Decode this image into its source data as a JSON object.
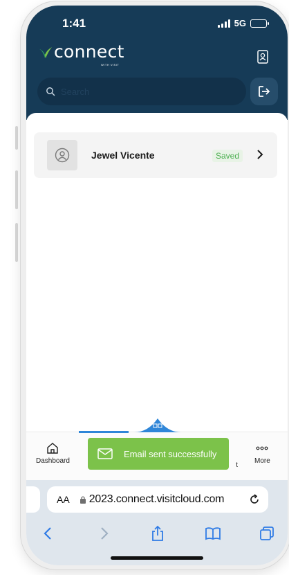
{
  "status_bar": {
    "time": "1:41",
    "network": "5G"
  },
  "header": {
    "brand": "connect",
    "brand_sub": "WITH VISIT",
    "search_placeholder": "Search",
    "colors": {
      "header_bg": "#163b57",
      "accent": "#2f86d8",
      "brand_v": "#2e9e5e"
    }
  },
  "contacts": [
    {
      "name": "Jewel Vicente",
      "status": "Saved"
    }
  ],
  "bottom_nav": {
    "items": [
      {
        "label": "Dashboard",
        "icon": "home-icon"
      },
      {
        "label": "More",
        "icon": "more-icon"
      }
    ],
    "partial_label": "t",
    "center_icon": "qr-scan-icon"
  },
  "toast": {
    "message": "Email sent successfully",
    "icon": "mail-icon",
    "color": "#7cc24a"
  },
  "browser": {
    "text_size_label": "AA",
    "url": "2023.connect.visitcloud.com",
    "toolbar_icons": [
      "back-icon",
      "forward-icon",
      "share-icon",
      "bookmarks-icon",
      "tabs-icon"
    ]
  }
}
